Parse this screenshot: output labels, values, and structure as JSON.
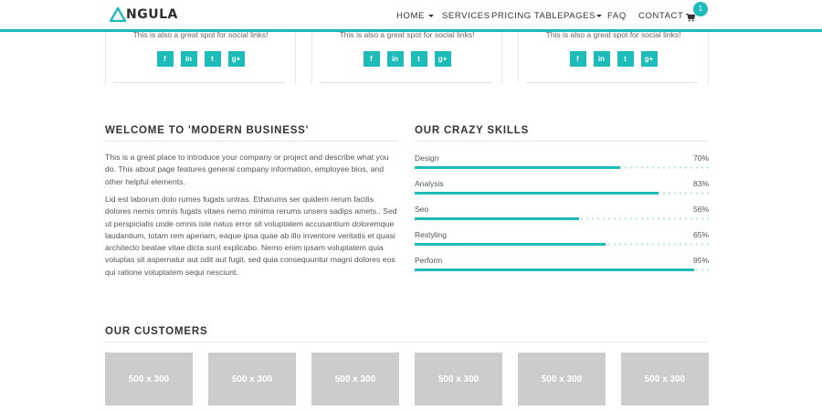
{
  "brand": {
    "name": "NGULA",
    "logo_letter": "A",
    "accent": "#1ebcb8"
  },
  "nav": {
    "home": "HOME",
    "services": "SERVICES",
    "pricing": "PRICING TABLE",
    "pages": "PAGES",
    "faq": "FAQ",
    "contact": "CONTACT",
    "cart_count": "1"
  },
  "team_cards": [
    {
      "text": "This is also a great spot for social links!",
      "socials": [
        "f",
        "in",
        "t",
        "g+"
      ]
    },
    {
      "text": "This is also a great spot for social links!",
      "socials": [
        "f",
        "in",
        "t",
        "g+"
      ]
    },
    {
      "text": "This is also a great spot for social links!",
      "socials": [
        "f",
        "in",
        "t",
        "g+"
      ]
    }
  ],
  "welcome": {
    "title": "WELCOME TO 'MODERN BUSINESS'",
    "para1": "This is a great place to introduce your company or project and describe what you do. This about page features general company information, employee bios, and other helpful elements.",
    "para2": "Lid est laborum dolo rumes fugats untras. Etharums ser quidem rerum facilis dolores nemis omnis fugats vitaes nemo minima rerums unsers sadips amets.. Sed ut perspiciatis unde omnis iste natus error sit voluptatem accusantium doloremque laudantium, totam rem aperiam, eaque ipsa quae ab illo inventore veritatis et quasi architecto beatae vitae dicta sunt explicabo. Nemo enim ipsam voluptatem quia voluptas sit aspernatur aut odit aut fugit, sed quia consequuntur magni dolores eos qui ratione voluptatem sequi nesciunt."
  },
  "skills": {
    "title": "OUR CRAZY SKILLS",
    "items": [
      {
        "label": "Design",
        "pct_text": "70%",
        "value": 0.7
      },
      {
        "label": "Analysis",
        "pct_text": "83%",
        "value": 0.83
      },
      {
        "label": "Seo",
        "pct_text": "56%",
        "value": 0.56
      },
      {
        "label": "Restyling",
        "pct_text": "65%",
        "value": 0.65
      },
      {
        "label": "Perform",
        "pct_text": "95%",
        "value": 0.95
      }
    ]
  },
  "customers": {
    "title": "OUR CUSTOMERS",
    "logos": [
      "500 x 300",
      "500 x 300",
      "500 x 300",
      "500 x 300",
      "500 x 300",
      "500 x 300"
    ]
  }
}
